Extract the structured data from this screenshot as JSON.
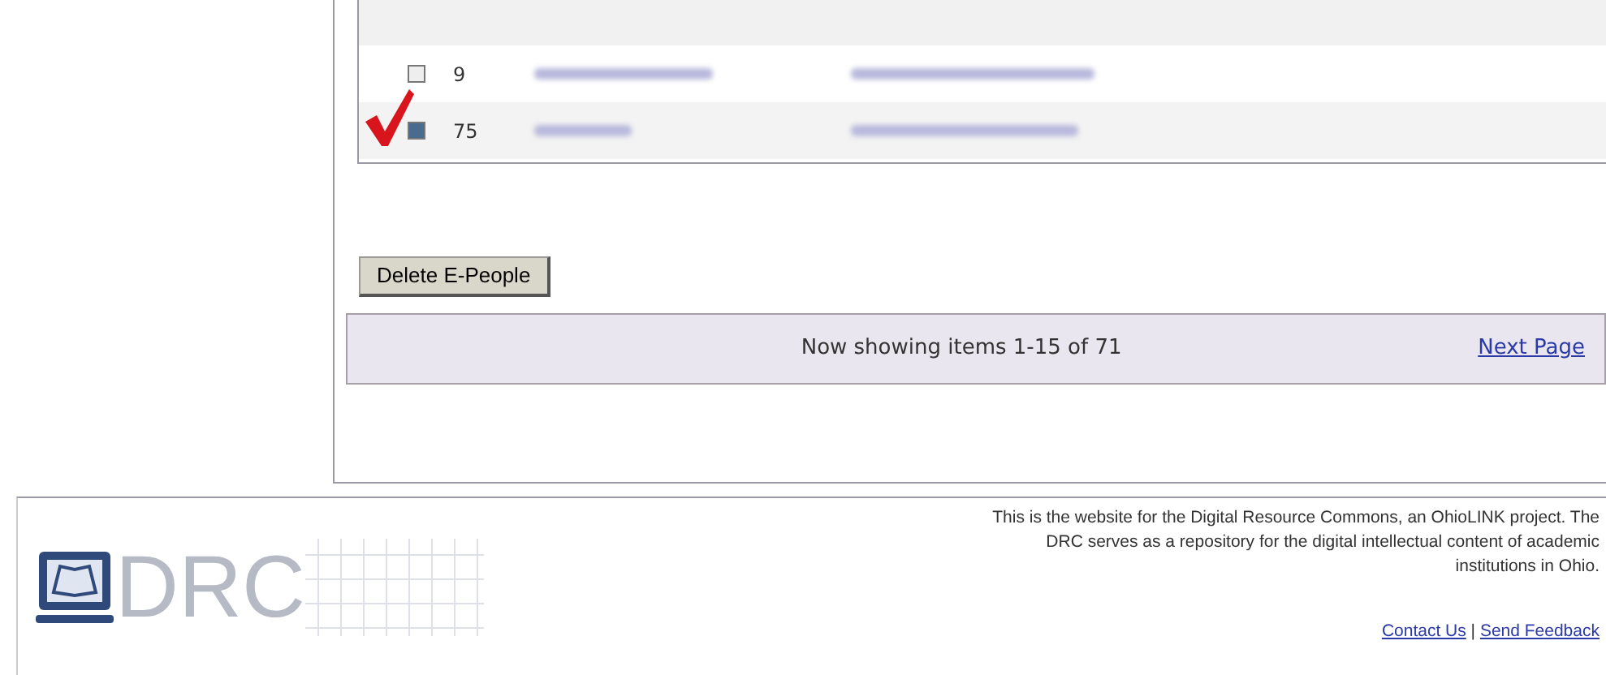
{
  "table": {
    "rows": [
      {
        "checked": false,
        "id": "9"
      },
      {
        "checked": true,
        "id": "75"
      }
    ]
  },
  "delete_button": "Delete E-People",
  "pager": {
    "status": "Now showing items 1-15 of 71",
    "next": "Next Page"
  },
  "footer": {
    "text": "This is the website for the Digital Resource Commons, an OhioLINK project. The DRC serves as a repository for the digital intellectual content of academic institutions in Ohio.",
    "links": [
      "Contact Us",
      "Send Feedback"
    ],
    "separator": "|",
    "logo": "DRC"
  }
}
